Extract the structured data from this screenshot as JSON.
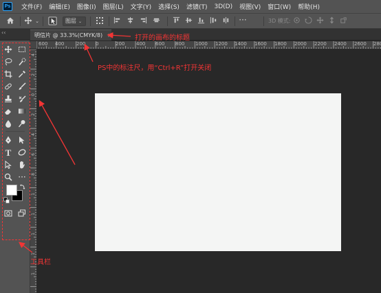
{
  "app": {
    "logo_text": "Ps"
  },
  "menu": [
    "文件(F)",
    "编辑(E)",
    "图像(I)",
    "图层(L)",
    "文字(Y)",
    "选择(S)",
    "滤镜(T)",
    "3D(D)",
    "视图(V)",
    "窗口(W)",
    "帮助(H)"
  ],
  "options_bar": {
    "layer_select_value": "图层",
    "mode_label": "3D 模式:"
  },
  "tab": {
    "title": "明信片 @ 33.3%(CMYK/8)",
    "close_glyph": "×"
  },
  "collapse_glyph": "‹‹",
  "ruler": {
    "h_labels": [
      "600",
      "400",
      "200",
      "0",
      "200",
      "400",
      "600",
      "800",
      "1000",
      "1200",
      "1400",
      "1600",
      "1800",
      "2000",
      "2200",
      "2400",
      "2600",
      "2800"
    ],
    "v_labels": [
      "4",
      "2",
      "0",
      "2",
      "4",
      "6",
      "8",
      "1",
      "1",
      "1",
      "1",
      "1"
    ]
  },
  "annotations": {
    "title_note": "打开的画布的标题",
    "ruler_note": "PS中的标注尺，用“Ctrl+R”打开关闭",
    "toolbar_note": "工具栏"
  },
  "colors": {
    "annotation": "#f23535",
    "canvas": "#f4f5f4",
    "workspace": "#282828",
    "panel": "#535353"
  },
  "icons": {
    "toolbar": [
      "move-icon",
      "marquee-icon",
      "lasso-icon",
      "quick-select-icon",
      "crop-icon",
      "eyedropper-icon",
      "healing-icon",
      "brush-icon",
      "stamp-icon",
      "history-brush-icon",
      "eraser-icon",
      "gradient-icon",
      "blur-icon",
      "dodge-icon",
      "pen-icon",
      "type-icon",
      "path-select-icon",
      "shape-icon",
      "hand-icon",
      "zoom-icon",
      "more-icon",
      "swap-colors-icon",
      "default-colors-icon",
      "quick-mask-icon",
      "screen-mode-icon"
    ]
  }
}
